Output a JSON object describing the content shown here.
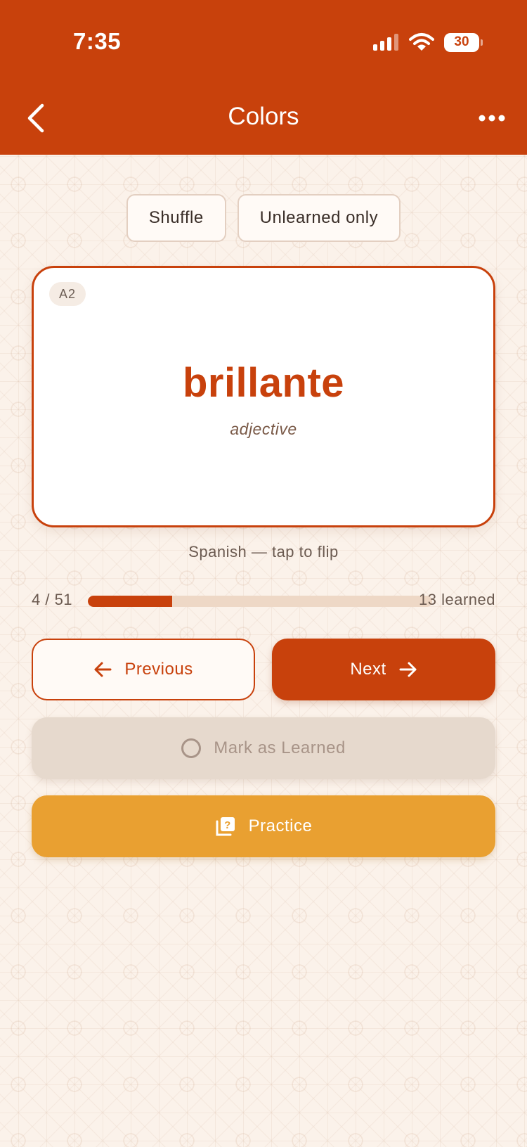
{
  "status_bar": {
    "time": "7:35",
    "battery": "30"
  },
  "header": {
    "title": "Colors",
    "back_icon": "chevron-left-icon",
    "menu_icon": "more-horizontal-icon"
  },
  "filters": {
    "shuffle_label": "Shuffle",
    "unlearned_label": "Unlearned only"
  },
  "card": {
    "level": "A2",
    "word": "brillante",
    "part_of_speech": "adjective",
    "hint": "Spanish — tap to flip"
  },
  "progress": {
    "position_label": "4 / 51",
    "learned_label": "13 learned",
    "fraction": 0.245
  },
  "actions": {
    "previous_label": "Previous",
    "next_label": "Next",
    "mark_learned_label": "Mark as Learned",
    "practice_label": "Practice"
  },
  "colors": {
    "primary": "#c8410c",
    "practice": "#e9a031",
    "background": "#fbf2ea",
    "disabled": "#e6d9cd"
  }
}
